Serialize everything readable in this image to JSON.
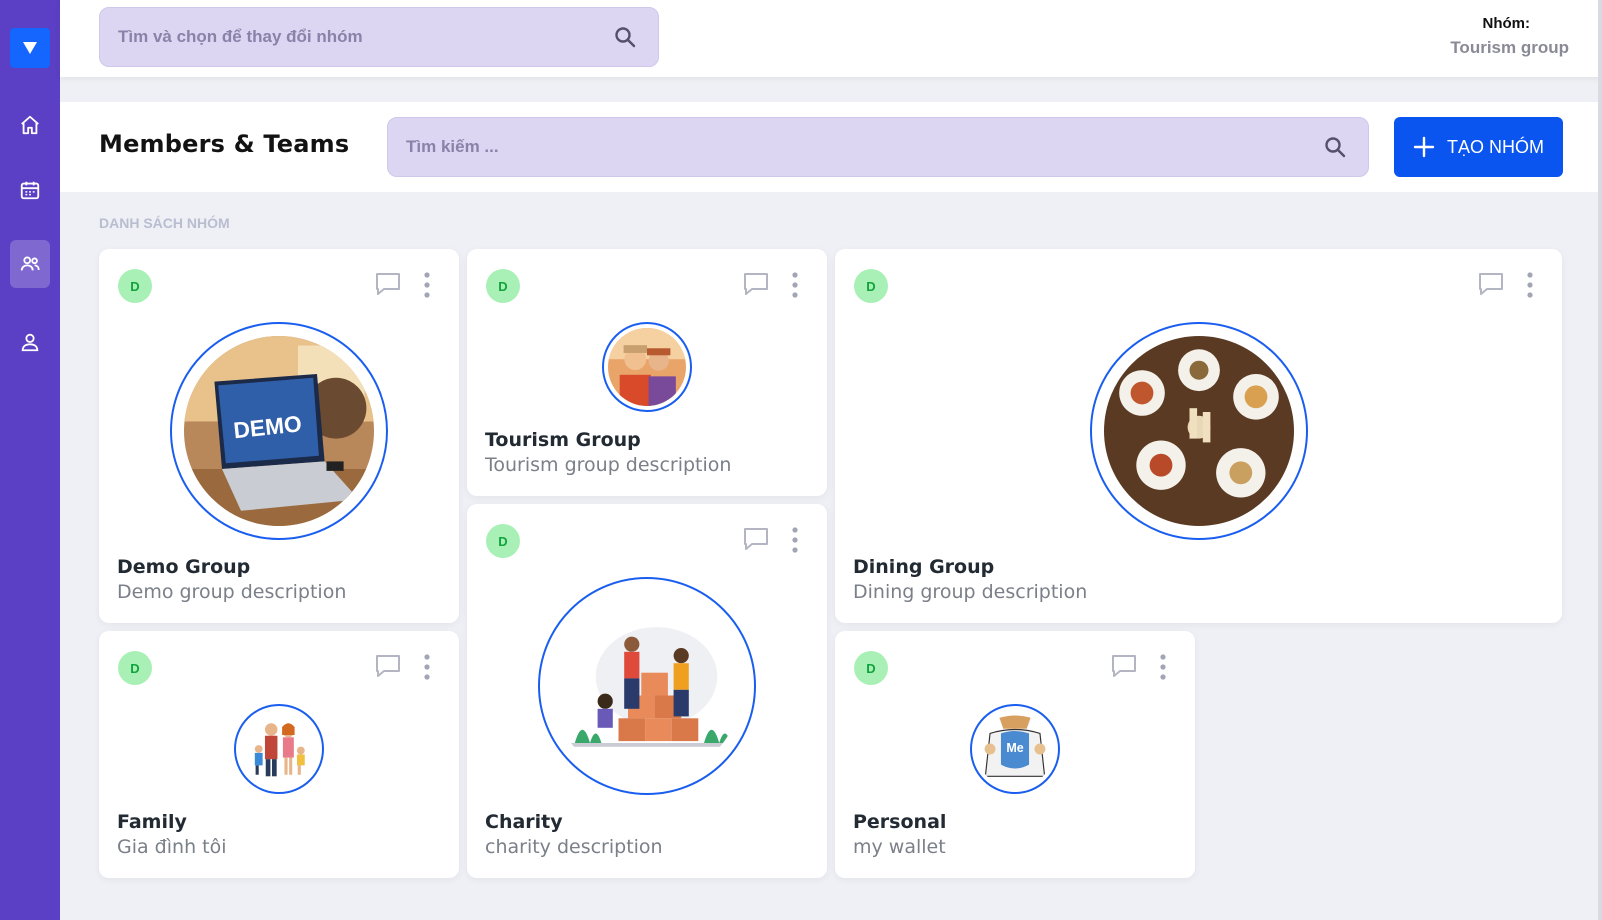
{
  "topbar": {
    "group_search_placeholder": "Tìm và chọn để thay đổi nhóm",
    "group_label": "Nhóm:",
    "group_value": "Tourism group"
  },
  "header": {
    "title": "Members & Teams",
    "search_placeholder": "Tìm kiếm ...",
    "create_label": "TẠO NHÓM"
  },
  "section_label": "DANH SÁCH NHÓM",
  "sidebar": {
    "items": [
      "home-icon",
      "calendar-icon",
      "users-icon",
      "user-icon"
    ],
    "active": "users-icon"
  },
  "groups": [
    {
      "badge": "D",
      "title": "Demo Group",
      "description": "Demo group description",
      "image": "demo-laptop"
    },
    {
      "badge": "D",
      "title": "Tourism Group",
      "description": "Tourism group description",
      "image": "tourism-friends"
    },
    {
      "badge": "D",
      "title": "Dining Group",
      "description": "Dining group description",
      "image": "dining-table"
    },
    {
      "badge": "D",
      "title": "Charity",
      "description": "charity description",
      "image": "charity-boxes"
    },
    {
      "badge": "D",
      "title": "Family",
      "description": "Gia đình tôi",
      "image": "family"
    },
    {
      "badge": "D",
      "title": "Personal",
      "description": "my wallet",
      "image": "me-hero"
    }
  ],
  "colors": {
    "sidebar": "#5b3fc4",
    "accent": "#0a55f0",
    "search_bg": "#dcd6f2",
    "badge_bg": "#a8f0b6",
    "badge_text": "#12a43c",
    "avatar_ring": "#1a5ef0"
  }
}
